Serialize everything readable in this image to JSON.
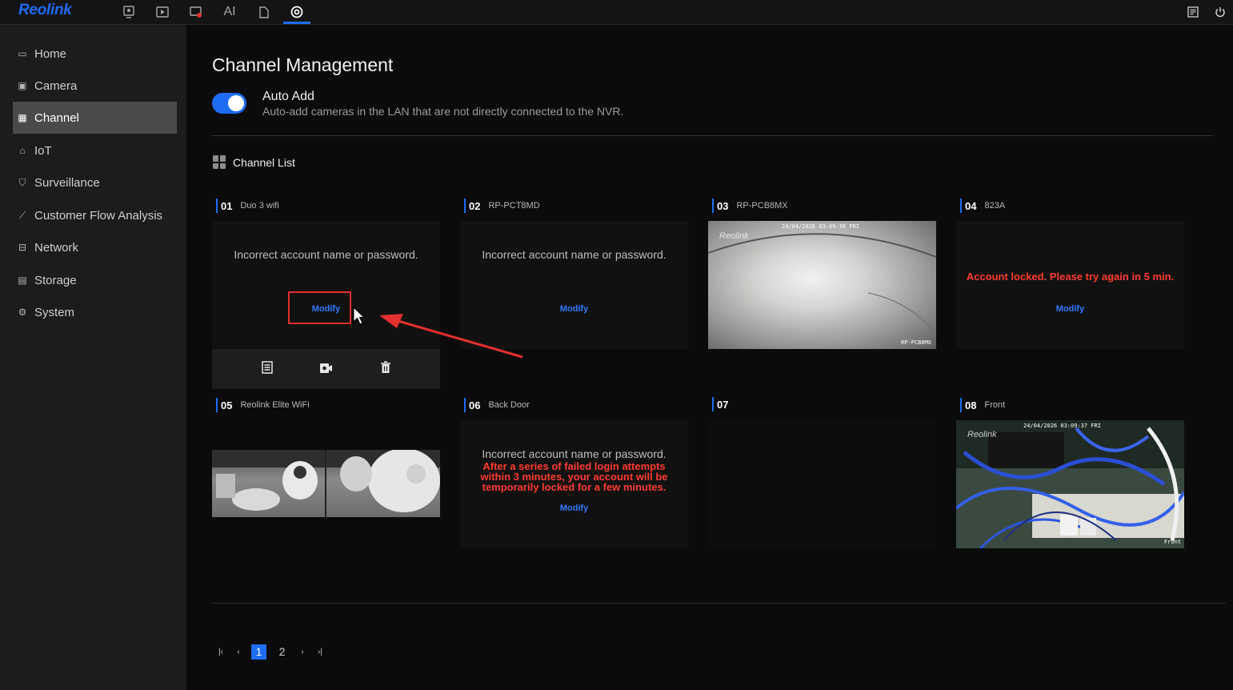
{
  "app": {
    "logo": "Reolink"
  },
  "topnav": [
    {
      "icon": "live-view-icon"
    },
    {
      "icon": "playback-icon"
    },
    {
      "icon": "alarm-icon"
    },
    {
      "label": "AI"
    },
    {
      "icon": "file-icon"
    },
    {
      "icon": "settings-icon"
    }
  ],
  "sidebar": {
    "items": [
      {
        "label": "Home",
        "icon": "home-icon"
      },
      {
        "label": "Camera",
        "icon": "camera-icon"
      },
      {
        "label": "Channel",
        "icon": "channel-icon",
        "active": true
      },
      {
        "label": "IoT",
        "icon": "iot-icon"
      },
      {
        "label": "Surveillance",
        "icon": "shield-icon"
      },
      {
        "label": "Customer Flow Analysis",
        "icon": "chart-icon"
      },
      {
        "label": "Network",
        "icon": "network-icon"
      },
      {
        "label": "Storage",
        "icon": "storage-icon"
      },
      {
        "label": "System",
        "icon": "gear-icon"
      }
    ]
  },
  "page": {
    "title": "Channel Management",
    "auto_add": {
      "title": "Auto Add",
      "description": "Auto-add cameras in the LAN that are not directly connected to the NVR.",
      "enabled": true
    },
    "channel_list_title": "Channel List"
  },
  "channels": [
    {
      "num": "01",
      "name": "Duo 3 wifi",
      "error": "Incorrect account name or password.",
      "action": "Modify"
    },
    {
      "num": "02",
      "name": "RP-PCT8MD",
      "error": "Incorrect account name or password.",
      "action": "Modify"
    },
    {
      "num": "03",
      "name": "RP-PCB8MX",
      "timestamp": "24/04/2026 03:09:38 FRI",
      "watermark": "Reolink",
      "overlay": "RP-PCB8MX"
    },
    {
      "num": "04",
      "name": "823A",
      "error": "Account locked. Please try again in 5 min.",
      "action": "Modify"
    },
    {
      "num": "05",
      "name": "Reolink Elite WiFi"
    },
    {
      "num": "06",
      "name": "Back Door",
      "error": "Incorrect account name or password.",
      "warning": "After a series of failed login attempts within 3 minutes, your account will be temporarily locked for a few minutes.",
      "action": "Modify"
    },
    {
      "num": "07",
      "name": ""
    },
    {
      "num": "08",
      "name": "Front",
      "timestamp": "24/04/2026 03:09:37 FRI",
      "watermark": "Reolink",
      "overlay": "Front"
    }
  ],
  "toolbar": [
    {
      "icon": "list-icon"
    },
    {
      "icon": "camera-settings-icon"
    },
    {
      "icon": "trash-icon"
    }
  ],
  "pagination": {
    "pages": [
      "1",
      "2"
    ],
    "current": "1"
  },
  "colors": {
    "accent": "#1e6cf2",
    "error": "#ff3b2f",
    "annotation": "#e53030"
  }
}
